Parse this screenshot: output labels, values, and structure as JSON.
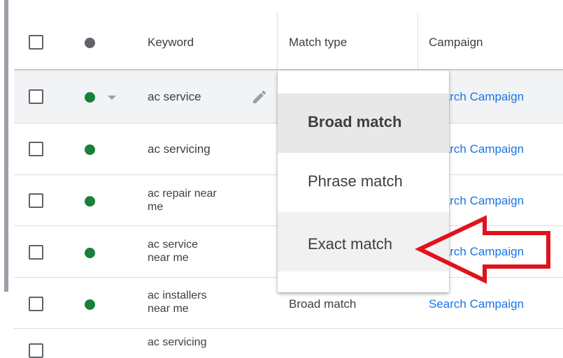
{
  "header": {
    "keyword": "Keyword",
    "match_type": "Match type",
    "campaign": "Campaign"
  },
  "rows": [
    {
      "keyword": "ac service",
      "match_type": "",
      "campaign": "Search Campaign",
      "status_color": "#188038"
    },
    {
      "keyword": "ac servicing",
      "match_type": "",
      "campaign": "Search Campaign",
      "status_color": "#188038"
    },
    {
      "keyword_line1": "ac repair near",
      "keyword_line2": "me",
      "match_type": "",
      "campaign": "Search Campaign",
      "status_color": "#188038"
    },
    {
      "keyword_line1": "ac service",
      "keyword_line2": "near me",
      "match_type": "",
      "campaign": "Search Campaign",
      "status_color": "#188038"
    },
    {
      "keyword_line1": "ac installers",
      "keyword_line2": "near me",
      "match_type": "Broad match",
      "campaign": "Search Campaign",
      "status_color": "#188038"
    },
    {
      "keyword_line1": "ac servicing",
      "match_type": "",
      "campaign": "",
      "status_color": "#188038"
    }
  ],
  "dropdown": {
    "options": [
      "Broad match",
      "Phrase match",
      "Exact match"
    ],
    "selected": "Broad match"
  },
  "icons": {
    "header_status": "status-dot-icon",
    "row_status": "enabled-dot-icon",
    "status_menu": "caret-down-icon",
    "edit": "pencil-icon",
    "annotation": "red-arrow-icon"
  },
  "colors": {
    "enabled": "#188038",
    "link": "#1a73e8",
    "annotation": "#e0121b"
  }
}
